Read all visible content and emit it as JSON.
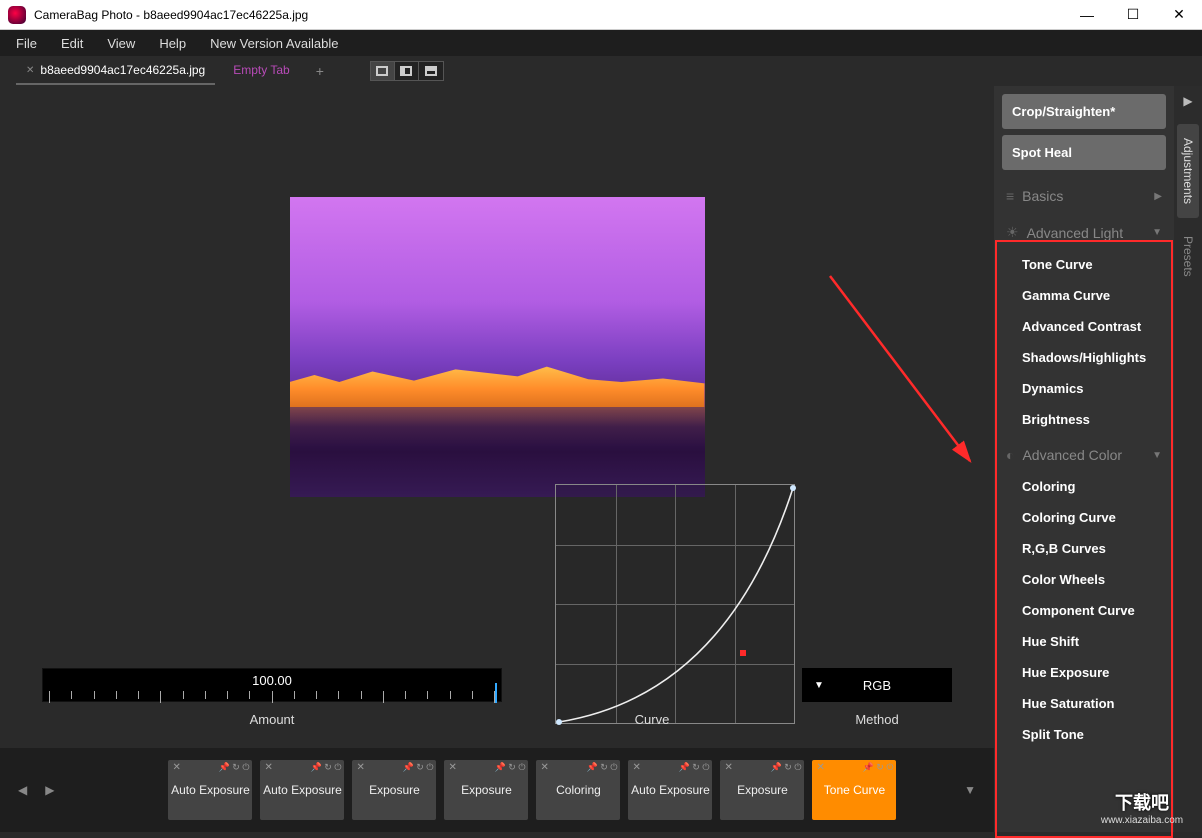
{
  "title": "CameraBag Photo - b8aeed9904ac17ec46225a.jpg",
  "menu": {
    "file": "File",
    "edit": "Edit",
    "view": "View",
    "help": "Help",
    "newVersion": "New Version Available"
  },
  "tabs": {
    "active": "b8aeed9904ac17ec46225a.jpg",
    "empty": "Empty Tab"
  },
  "adjustments": {
    "crop": "Crop/Straighten*",
    "spot": "Spot Heal",
    "basics": "Basics",
    "advLight": "Advanced Light",
    "advLightItems": [
      "Tone Curve",
      "Gamma Curve",
      "Advanced Contrast",
      "Shadows/Highlights",
      "Dynamics",
      "Brightness"
    ],
    "advColor": "Advanced Color",
    "advColorItems": [
      "Coloring",
      "Coloring Curve",
      "R,G,B Curves",
      "Color Wheels",
      "Component Curve",
      "Hue Shift",
      "Hue Exposure",
      "Hue Saturation",
      "Split Tone"
    ]
  },
  "sideTabs": {
    "adjustments": "Adjustments",
    "presets": "Presets"
  },
  "controls": {
    "amountLabel": "Amount",
    "amountValue": "100.00",
    "curveLabel": "Curve",
    "methodLabel": "Method",
    "methodValue": "RGB"
  },
  "filterStrip": [
    "Auto Exposure",
    "Auto Exposure",
    "Exposure",
    "Exposure",
    "Coloring",
    "Auto Exposure",
    "Exposure",
    "Tone Curve"
  ],
  "watermark": {
    "big": "下载吧",
    "small": "www.xiazaiba.com"
  }
}
